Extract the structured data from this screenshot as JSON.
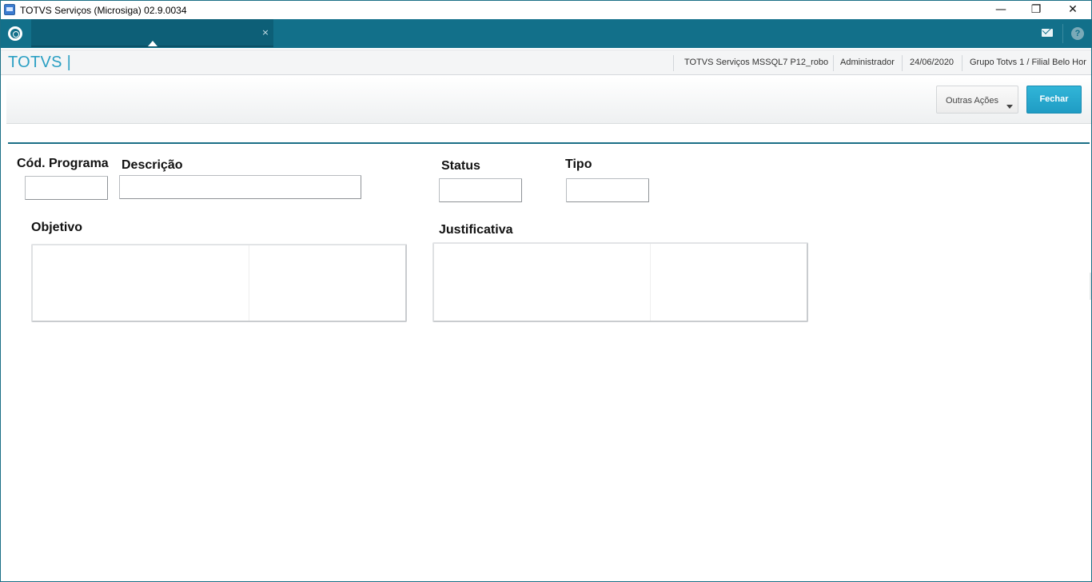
{
  "window": {
    "title": "TOTVS Serviços (Microsiga) 02.9.0034",
    "controls": {
      "minimize": "—",
      "maximize": "❐",
      "close": "✕"
    }
  },
  "tabbar": {
    "home_icon": "totvs-logo-icon",
    "tab_close": "×",
    "mail_icon": "mail-icon",
    "help_icon": "?"
  },
  "header": {
    "brand": "TOTVS |",
    "environment": "TOTVS Serviços MSSQL7 P12_robo",
    "user": "Administrador",
    "date": "24/06/2020",
    "company": "Grupo Totvs 1 / Filial Belo Hor"
  },
  "toolbar": {
    "other_actions": "Outras Ações",
    "close": "Fechar"
  },
  "form": {
    "cod_programa": {
      "label": "Cód. Programa",
      "value": ""
    },
    "descricao": {
      "label": "Descrição",
      "value": ""
    },
    "status": {
      "label": "Status",
      "value": ""
    },
    "tipo": {
      "label": "Tipo",
      "value": ""
    },
    "objetivo": {
      "label": "Objetivo",
      "value": ""
    },
    "justificativa": {
      "label": "Justificativa",
      "value": ""
    }
  },
  "colors": {
    "accent": "#12708a",
    "brand": "#2a9fc3",
    "primary_button": "#1f9cc4"
  }
}
